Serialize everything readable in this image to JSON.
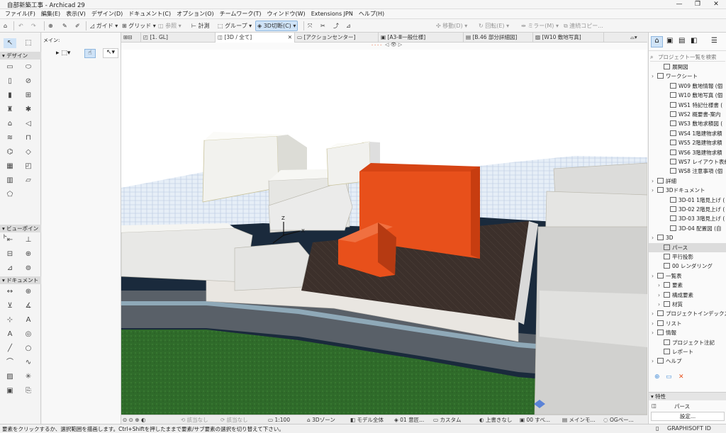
{
  "window": {
    "title": "自部新築工事 - Archicad 29",
    "controls": [
      "—",
      "❐",
      "✕"
    ]
  },
  "menu": [
    "ファイル(F)",
    "編集(E)",
    "表示(V)",
    "デザイン(D)",
    "ドキュメント(C)",
    "オプション(O)",
    "チームワーク(T)",
    "ウィンドウ(W)",
    "Extensions JPN",
    "ヘルプ(H)"
  ],
  "toolbar": {
    "guide": "ガイド",
    "grid": "グリッド",
    "ref": "参照",
    "measure": "計測",
    "group": "グループ",
    "section3d": "3D切断(C)",
    "move": "移動(D)",
    "rotate": "回転(E)",
    "mirror": "ミラー(M)",
    "multicopy": "連続コピー..."
  },
  "toolbox": {
    "info_label": "メイン:",
    "sections": [
      "デザイン",
      "ビューポイント",
      "ドキュメント"
    ]
  },
  "tabs": [
    "[1. GL]",
    "[3D / 全て]",
    "[アクションセンター]",
    "[A3-Ⅲ一般仕様]",
    "[B.46 部分詳細図]",
    "[W10 敷地写真]"
  ],
  "subbar": {
    "left": "- - - -",
    "right": "◁ 👁 ▷"
  },
  "statusbar": {
    "undo_label": "該当なし",
    "redo_label": "該当なし",
    "scale": "1:100",
    "zone": "3Dゾーン",
    "model": "モデル全体",
    "layer": "01 意匠...",
    "custom": "カスタム",
    "overwrite": "上書きなし",
    "level": "00 すべ...",
    "mesh": "メインモ...",
    "og": "OGペー..."
  },
  "navigator": {
    "search_placeholder": "プロジェクト一覧を検索",
    "items": [
      {
        "label": "展開図",
        "indent": 1,
        "type": "view"
      },
      {
        "label": "ワークシート",
        "indent": 0,
        "type": "folder"
      },
      {
        "label": "W09 敷地情報 (個",
        "indent": 2,
        "type": "view"
      },
      {
        "label": "W10 敷地写真 (個",
        "indent": 2,
        "type": "view"
      },
      {
        "label": "WS1 特記仕様書 (",
        "indent": 2,
        "type": "view"
      },
      {
        "label": "WS2 概要書-案内",
        "indent": 2,
        "type": "view"
      },
      {
        "label": "WS3 敷地求積図 (",
        "indent": 2,
        "type": "view"
      },
      {
        "label": "WS4 1階建物求積",
        "indent": 2,
        "type": "view"
      },
      {
        "label": "WS5 2階建物求積",
        "indent": 2,
        "type": "view"
      },
      {
        "label": "WS6 3階建物求積",
        "indent": 2,
        "type": "view"
      },
      {
        "label": "WS7 レイアウト表紙",
        "indent": 2,
        "type": "view"
      },
      {
        "label": "WS8 注意事項 (個",
        "indent": 2,
        "type": "view"
      },
      {
        "label": "詳細",
        "indent": 0,
        "type": "folder"
      },
      {
        "label": "3Dドキュメント",
        "indent": 0,
        "type": "folder"
      },
      {
        "label": "3D-01 1階見上げ (",
        "indent": 2,
        "type": "view"
      },
      {
        "label": "3D-02 2階見上げ (",
        "indent": 2,
        "type": "view"
      },
      {
        "label": "3D-03 3階見上げ (",
        "indent": 2,
        "type": "view"
      },
      {
        "label": "3D-04 配置図 (自",
        "indent": 2,
        "type": "view"
      },
      {
        "label": "3D",
        "indent": 0,
        "type": "folder"
      },
      {
        "label": "パース",
        "indent": 1,
        "type": "view"
      },
      {
        "label": "平行投影",
        "indent": 1,
        "type": "view"
      },
      {
        "label": "00 レンダリング",
        "indent": 1,
        "type": "view"
      },
      {
        "label": "一覧表",
        "indent": 0,
        "type": "folder"
      },
      {
        "label": "要素",
        "indent": 1,
        "type": "folder"
      },
      {
        "label": "構成要素",
        "indent": 1,
        "type": "folder"
      },
      {
        "label": "材質",
        "indent": 1,
        "type": "folder"
      },
      {
        "label": "プロジェクトインデックス",
        "indent": 0,
        "type": "folder"
      },
      {
        "label": "リスト",
        "indent": 0,
        "type": "folder"
      },
      {
        "label": "情報",
        "indent": 0,
        "type": "folder"
      },
      {
        "label": "プロジェクト注記",
        "indent": 1,
        "type": "view"
      },
      {
        "label": "レポート",
        "indent": 1,
        "type": "view"
      },
      {
        "label": "ヘルプ",
        "indent": 0,
        "type": "folder"
      }
    ],
    "selected_index": 19,
    "properties_header": "特性",
    "properties_value": "パース",
    "settings_button": "設定..."
  },
  "status_message": "要素をクリックするか、選択範囲を描画します。Ctrl+Shiftを押したままで要素/サブ要素の選択を切り替えて下さい。",
  "brand": "GRAPHISOFT ID",
  "accent": "#e8501b"
}
